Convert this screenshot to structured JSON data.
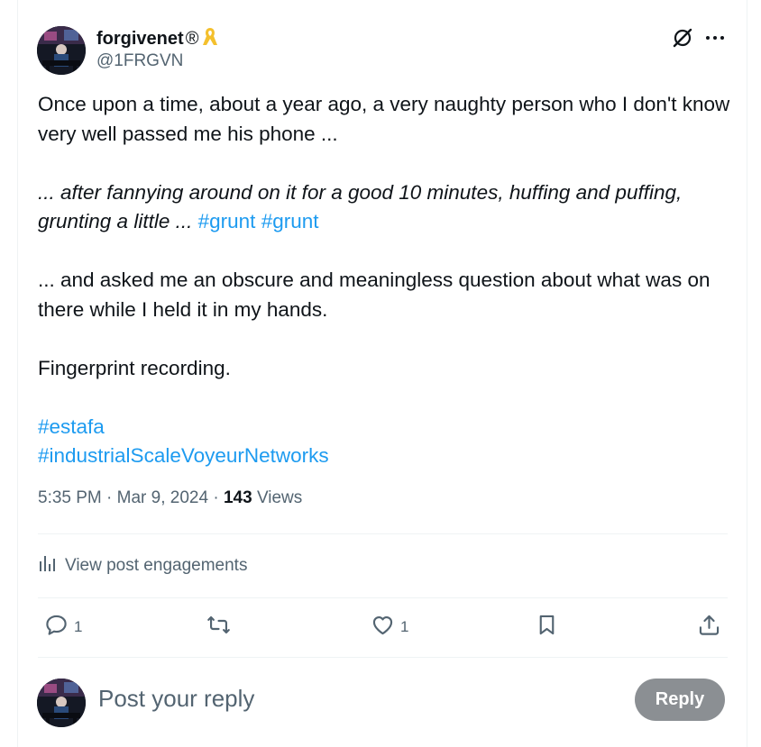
{
  "author": {
    "display_name": "forgivenet",
    "registered_mark": "®",
    "ribbon_icon": "yellow-ribbon-icon",
    "handle": "@1FRGVN"
  },
  "post": {
    "para1": "Once upon a time, about a year ago, a very naughty person who I don't know very well passed me his phone ...",
    "para2_italic": "... after fannying around on it for a good 10 minutes, huffing and puffing, grunting a little ...",
    "para2_tag1": "#grunt",
    "para2_tag2": "#grunt",
    "para3": "... and asked me an obscure and meaningless question about what was on there while I held it in my hands.",
    "para4": "Fingerprint recording.",
    "hashtag1": "#estafa",
    "hashtag2": "#industrialScaleVoyeurNetworks"
  },
  "meta": {
    "time": "5:35 PM",
    "date": "Mar 9, 2024",
    "separator": "·",
    "views_count": "143",
    "views_label": "Views"
  },
  "engagements": {
    "label": "View post engagements"
  },
  "actions": {
    "reply_count": "1",
    "repost_count": "",
    "like_count": "1"
  },
  "reply_box": {
    "placeholder": "Post your reply",
    "button_label": "Reply"
  },
  "colors": {
    "link": "#1d9bf0",
    "secondary_text": "#536471",
    "reply_button_disabled": "#8b8f93"
  }
}
